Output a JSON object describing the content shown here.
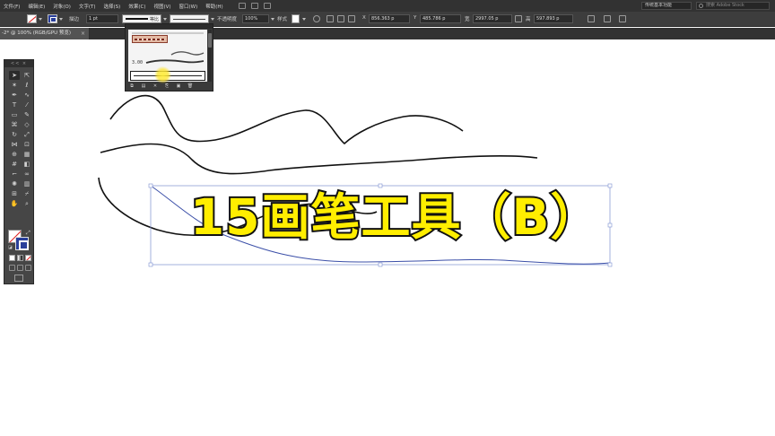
{
  "menubar": {
    "items": [
      "文件(F)",
      "编辑(E)",
      "对象(O)",
      "文字(T)",
      "选择(S)",
      "效果(C)",
      "视图(V)",
      "窗口(W)",
      "帮助(H)"
    ],
    "workspace": "传统基本功能",
    "stock_search": "搜索 Adobe Stock"
  },
  "controlbar": {
    "stroke_label": "描边",
    "stroke_weight": "1 pt",
    "stroke_style": "等比",
    "opacity_label": "不透明度",
    "opacity_value": "100%",
    "style_label": "样式",
    "x_label": "X",
    "x_value": "856.363 p",
    "y_label": "Y",
    "y_value": "485.786 p",
    "w_label": "宽",
    "w_value": "2997.05 p",
    "h_label": "高",
    "h_value": "597.893 p"
  },
  "document": {
    "tab_label": "-2* @ 100% (RGB/GPU 预览)",
    "close": "×"
  },
  "tools_panel": {
    "header": "<< ×",
    "tools": [
      {
        "name": "selection-tool",
        "glyph": "➤"
      },
      {
        "name": "direct-selection-tool",
        "glyph": "⇱"
      },
      {
        "name": "magic-wand-tool",
        "glyph": "✶"
      },
      {
        "name": "lasso-tool",
        "glyph": "ℓ"
      },
      {
        "name": "pen-tool",
        "glyph": "✒"
      },
      {
        "name": "curvature-tool",
        "glyph": "∿"
      },
      {
        "name": "type-tool",
        "glyph": "T"
      },
      {
        "name": "line-tool",
        "glyph": "⁄"
      },
      {
        "name": "rectangle-tool",
        "glyph": "▭"
      },
      {
        "name": "paintbrush-tool",
        "glyph": "✎"
      },
      {
        "name": "shaper-tool",
        "glyph": "⌘"
      },
      {
        "name": "eraser-tool",
        "glyph": "◇"
      },
      {
        "name": "rotate-tool",
        "glyph": "↻"
      },
      {
        "name": "scale-tool",
        "glyph": "⤢"
      },
      {
        "name": "width-tool",
        "glyph": "⋈"
      },
      {
        "name": "free-transform-tool",
        "glyph": "⊡"
      },
      {
        "name": "shape-builder-tool",
        "glyph": "⊕"
      },
      {
        "name": "perspective-grid-tool",
        "glyph": "▦"
      },
      {
        "name": "mesh-tool",
        "glyph": "#"
      },
      {
        "name": "gradient-tool",
        "glyph": "◧"
      },
      {
        "name": "eyedropper-tool",
        "glyph": "⌐"
      },
      {
        "name": "blend-tool",
        "glyph": "∞"
      },
      {
        "name": "symbol-sprayer-tool",
        "glyph": "✺"
      },
      {
        "name": "column-graph-tool",
        "glyph": "▥"
      },
      {
        "name": "artboard-tool",
        "glyph": "⊞"
      },
      {
        "name": "slice-tool",
        "glyph": "⌿"
      },
      {
        "name": "hand-tool",
        "glyph": "✋"
      },
      {
        "name": "zoom-tool",
        "glyph": "⌕"
      }
    ],
    "fill_color": "#ffffff",
    "stroke_color": "#2a3f9a"
  },
  "brushes_panel": {
    "stroke_value": "3.00",
    "footer": [
      "⧉",
      "▤",
      "✕",
      "⎘",
      "▣",
      "🗑"
    ]
  },
  "canvas": {
    "stroke_color": "#111111",
    "selected_path_color": "#3b4fa8"
  },
  "overlay": {
    "title": "15画笔工具（B）",
    "fill": "#ffee00",
    "outline": "#111111"
  }
}
